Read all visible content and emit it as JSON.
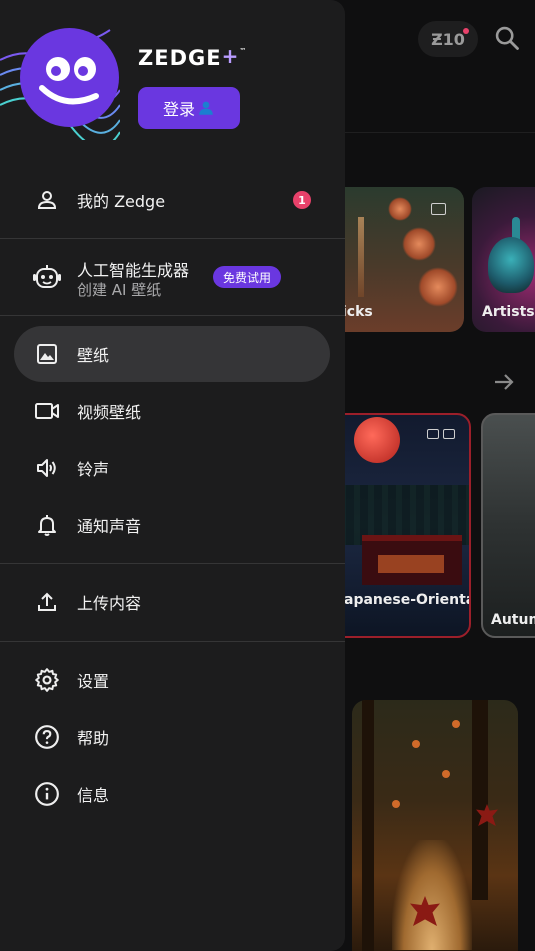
{
  "topbar": {
    "credits": "Ƶ10",
    "search_icon": "search-icon"
  },
  "background_cards": {
    "card_a_label": "icks",
    "card_b_label": "Artists C",
    "card_c_label": "apanese-Orienta",
    "card_d_label": "Autum"
  },
  "drawer": {
    "brand": "ZEDGE",
    "brand_plus": "+",
    "brand_tm": "™",
    "login_label": "登录",
    "my_zedge": {
      "label": "我的 Zedge",
      "badge": "1"
    },
    "ai_generator": {
      "title": "人工智能生成器",
      "subtitle": "创建 AI 壁纸",
      "trial": "免费试用"
    },
    "items": [
      {
        "label": "壁纸",
        "icon": "image-icon",
        "selected": true
      },
      {
        "label": "视频壁纸",
        "icon": "video-icon",
        "selected": false
      },
      {
        "label": "铃声",
        "icon": "speaker-icon",
        "selected": false
      },
      {
        "label": "通知声音",
        "icon": "bell-icon",
        "selected": false
      }
    ],
    "upload": {
      "label": "上传内容"
    },
    "footer_items": [
      {
        "label": "设置",
        "icon": "gear-icon"
      },
      {
        "label": "帮助",
        "icon": "help-icon"
      },
      {
        "label": "信息",
        "icon": "info-icon"
      }
    ]
  },
  "colors": {
    "accent": "#6a37e0",
    "badge": "#e8416a",
    "drawer_bg": "#1c1c1d",
    "selected_bg": "#353537"
  }
}
